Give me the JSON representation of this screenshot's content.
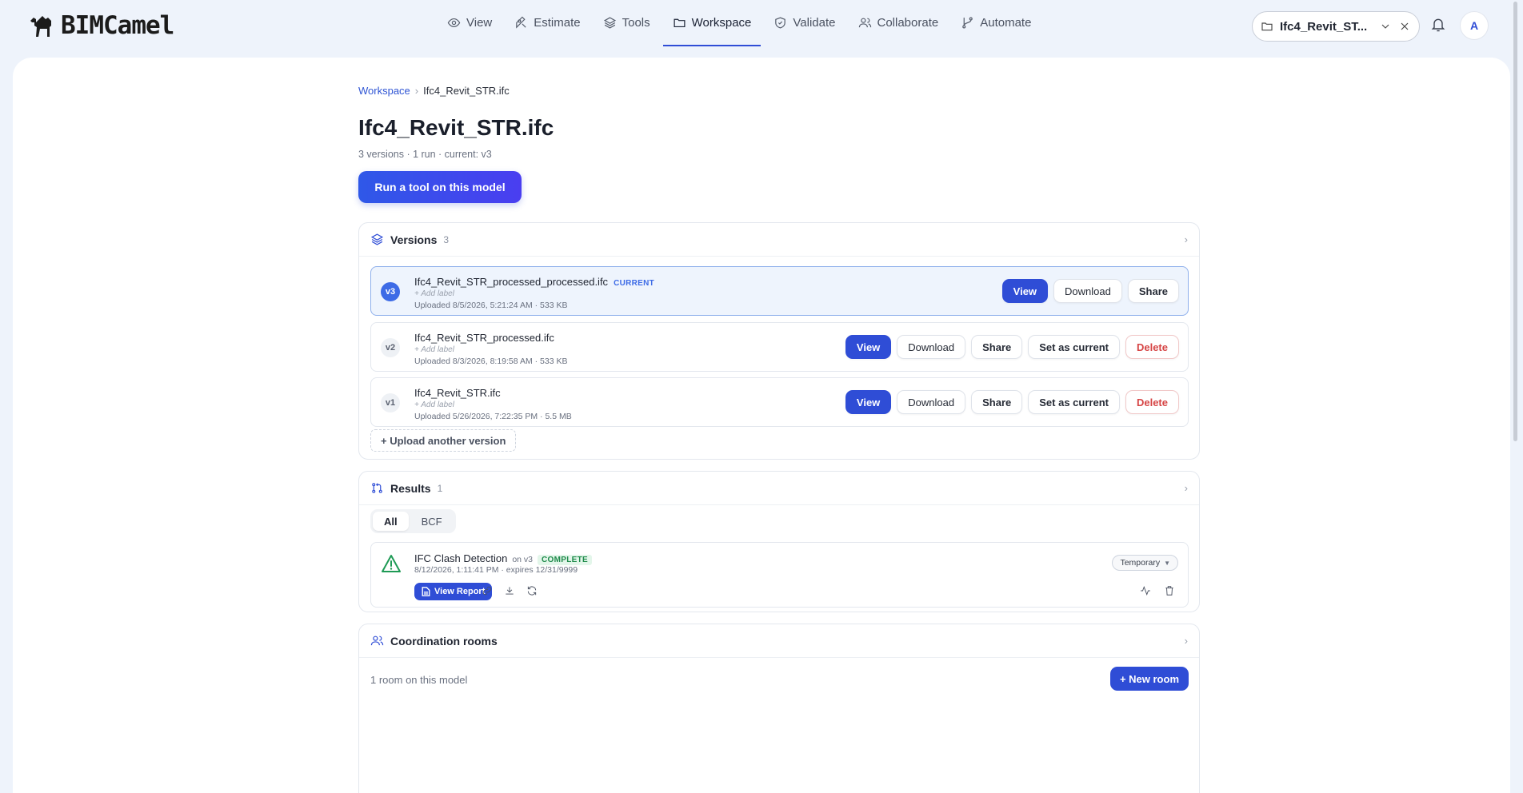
{
  "brand": {
    "name": "BIMCamel"
  },
  "nav": {
    "items": [
      {
        "label": "View",
        "icon": "eye-icon",
        "active": false
      },
      {
        "label": "Estimate",
        "icon": "estimate-icon",
        "active": false
      },
      {
        "label": "Tools",
        "icon": "layers-icon",
        "active": false
      },
      {
        "label": "Workspace",
        "icon": "folder-icon",
        "active": true
      },
      {
        "label": "Validate",
        "icon": "shield-check-icon",
        "active": false
      },
      {
        "label": "Collaborate",
        "icon": "users-icon",
        "active": false
      },
      {
        "label": "Automate",
        "icon": "git-branch-icon",
        "active": false
      }
    ]
  },
  "model_picker": {
    "label": "Ifc4_Revit_ST..."
  },
  "user": {
    "initial": "A"
  },
  "breadcrumb": {
    "root": "Workspace",
    "current": "Ifc4_Revit_STR.ifc"
  },
  "page": {
    "title": "Ifc4_Revit_STR.ifc",
    "subtitle": "3 versions · 1 run · current: v3",
    "run_button": "Run a tool on this model"
  },
  "versions": {
    "title": "Versions",
    "count": "3",
    "add_label": "+ Add label",
    "upload_label": "+ Upload another version",
    "items": [
      {
        "badge": "v3",
        "name": "Ifc4_Revit_STR_processed_processed.ifc",
        "tag": "CURRENT",
        "meta": "Uploaded 8/5/2026, 5:21:24 AM · 533 KB",
        "actions": {
          "view": "View",
          "download": "Download",
          "share": "Share"
        }
      },
      {
        "badge": "v2",
        "name": "Ifc4_Revit_STR_processed.ifc",
        "tag": "",
        "meta": "Uploaded 8/3/2026, 8:19:58 AM · 533 KB",
        "actions": {
          "view": "View",
          "download": "Download",
          "share": "Share",
          "set_current": "Set as current",
          "delete": "Delete"
        }
      },
      {
        "badge": "v1",
        "name": "Ifc4_Revit_STR.ifc",
        "tag": "",
        "meta": "Uploaded 5/26/2026, 7:22:35 PM · 5.5 MB",
        "actions": {
          "view": "View",
          "download": "Download",
          "share": "Share",
          "set_current": "Set as current",
          "delete": "Delete"
        }
      }
    ]
  },
  "results": {
    "title": "Results",
    "count": "1",
    "tabs": [
      "All",
      "BCF"
    ],
    "active_tab": "All",
    "items": [
      {
        "name": "IFC Clash Detection",
        "on": "on v3",
        "status": "COMPLETE",
        "meta": "8/12/2026, 1:11:41 PM  · expires 12/31/9999",
        "report_button": "View Report",
        "retention": "Temporary"
      }
    ]
  },
  "rooms": {
    "title": "Coordination rooms",
    "summary": "1 room on this model",
    "new_button": "+ New room"
  },
  "colors": {
    "accent": "#2f4dd6",
    "success": "#1e8a4a",
    "danger": "#d64545",
    "current_bg": "#eef4fd"
  }
}
